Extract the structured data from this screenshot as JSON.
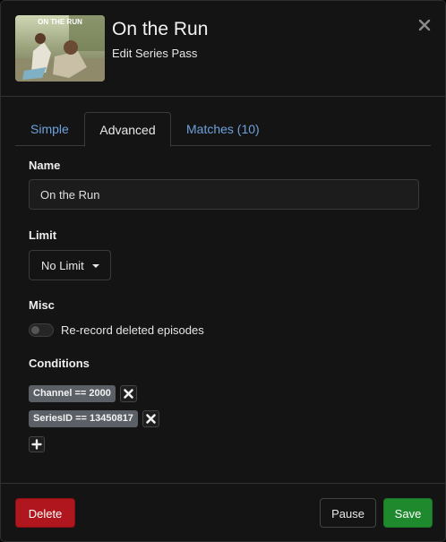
{
  "header": {
    "title": "On the Run",
    "subtitle": "Edit Series Pass",
    "thumbnail_text": "ON THE RUN"
  },
  "tabs": [
    {
      "label": "Simple",
      "active": false
    },
    {
      "label": "Advanced",
      "active": true
    },
    {
      "label": "Matches (10)",
      "active": false
    }
  ],
  "form": {
    "name_label": "Name",
    "name_value": "On the Run",
    "limit_label": "Limit",
    "limit_value": "No Limit",
    "misc_label": "Misc",
    "rerecord_label": "Re-record deleted episodes",
    "rerecord_enabled": false,
    "conditions_label": "Conditions",
    "conditions": [
      {
        "text": "Channel == 2000"
      },
      {
        "text": "SeriesID == 13450817"
      }
    ]
  },
  "footer": {
    "delete_label": "Delete",
    "pause_label": "Pause",
    "save_label": "Save"
  },
  "colors": {
    "background": "#141414",
    "link": "#6ea1dd",
    "danger": "#b0161d",
    "success": "#1f8a2d",
    "badge": "#5b6066"
  },
  "icons": [
    "close-icon",
    "remove-icon",
    "plus-icon",
    "caret-down-icon"
  ]
}
